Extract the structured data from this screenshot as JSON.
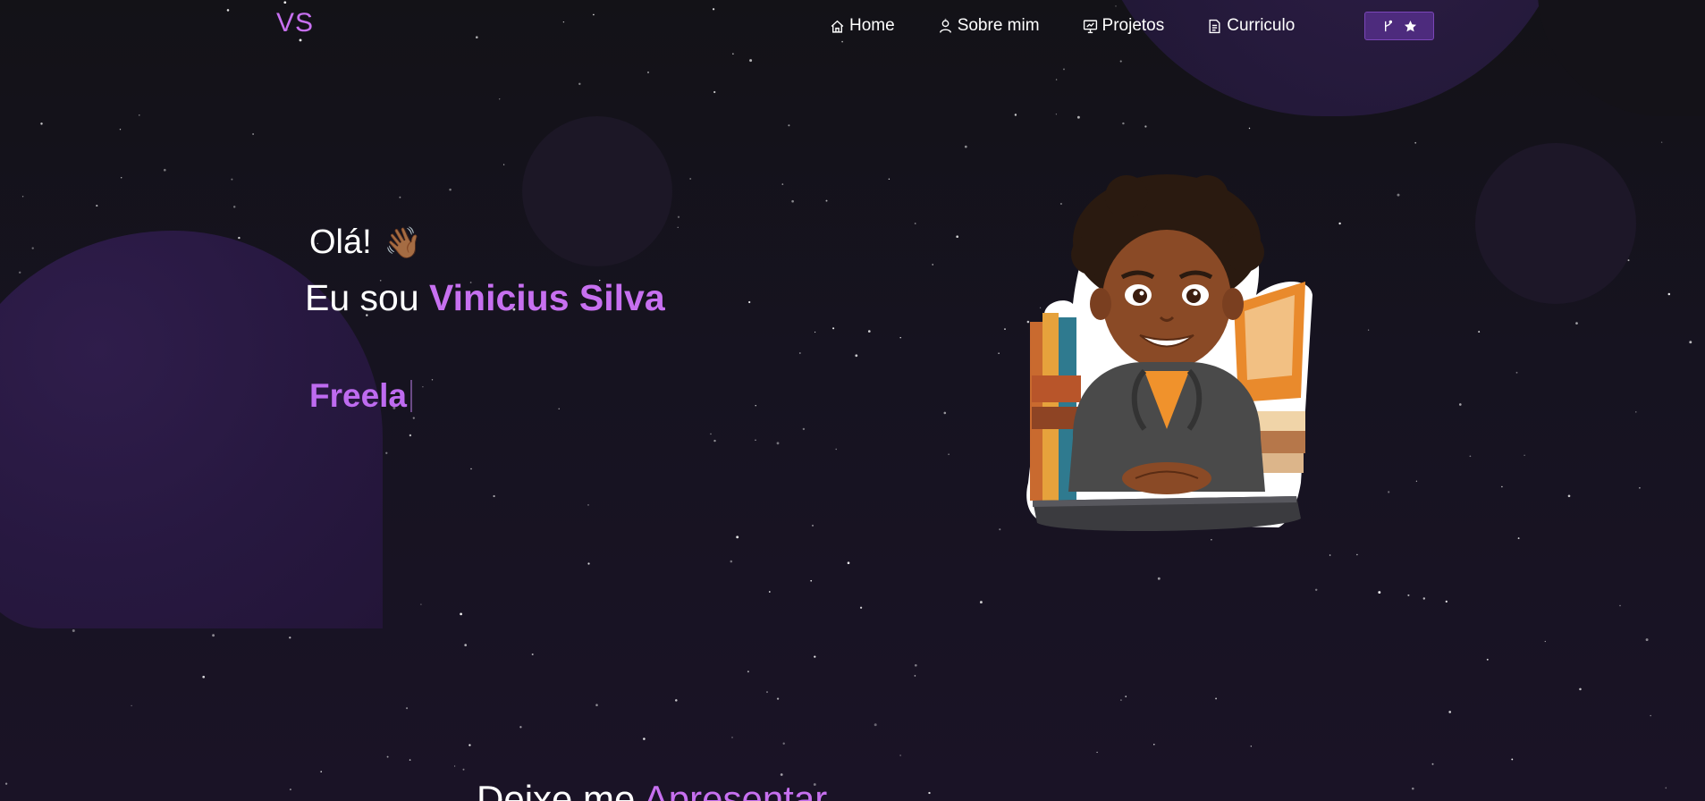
{
  "navbar": {
    "logo": "VS",
    "links": [
      {
        "label": "Home",
        "icon": "home-icon"
      },
      {
        "label": "Sobre mim",
        "icon": "user-icon"
      },
      {
        "label": "Projetos",
        "icon": "presentation-icon"
      },
      {
        "label": "Curriculo",
        "icon": "document-icon"
      }
    ],
    "github_button": {
      "icons": [
        "git-fork-icon",
        "star-icon"
      ]
    }
  },
  "hero": {
    "greeting": "Olá!",
    "wave_emoji": "👋🏾",
    "intro_prefix": "Eu sou ",
    "name": "Vinicius Silva",
    "typed_text": "Freela"
  },
  "about_section": {
    "title_prefix": "Deixe me ",
    "title_highlight": "Apresentar"
  },
  "colors": {
    "accent": "#c770f0",
    "background": "#141218",
    "button": "#4d2b7d"
  }
}
